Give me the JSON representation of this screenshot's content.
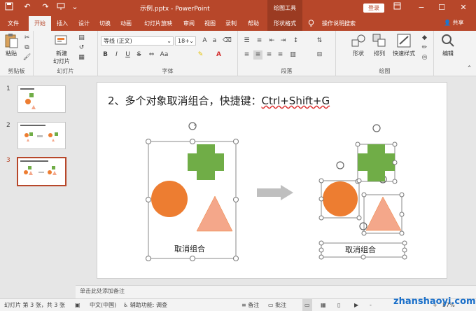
{
  "titlebar": {
    "file_title": "示例.pptx  -  PowerPoint",
    "context_label": "绘图工具",
    "login_label": "登录"
  },
  "tabs": {
    "items": [
      "文件",
      "开始",
      "插入",
      "设计",
      "切换",
      "动画",
      "幻灯片放映",
      "审阅",
      "视图",
      "录制",
      "帮助",
      "形状格式"
    ],
    "tell_me": "操作说明搜索",
    "share": "共享"
  },
  "ribbon": {
    "clipboard": {
      "paste": "粘贴",
      "label": "剪贴板"
    },
    "slides": {
      "new_slide_line1": "新建",
      "new_slide_line2": "幻灯片",
      "label": "幻灯片"
    },
    "font": {
      "font_name": "等线 (正文)",
      "font_size": "18+",
      "label": "字体",
      "bold": "B",
      "italic": "I",
      "underline": "U",
      "strike": "S",
      "font_color_glyph": "A"
    },
    "paragraph": {
      "label": "段落"
    },
    "drawing": {
      "shape": "形状",
      "arrange": "排列",
      "quick_styles": "快速样式",
      "label": "绘图"
    },
    "editing": {
      "label": "编辑"
    }
  },
  "slides_panel": {
    "numbers": [
      "1",
      "2",
      "3"
    ],
    "active_index": 3
  },
  "slide": {
    "title_prefix": "2、多个对象取消组合，快捷键：",
    "title_shortcut": "Ctrl+Shift+G",
    "left_caption": "取消组合",
    "right_caption": "取消组合"
  },
  "notes": {
    "placeholder": "单击此处添加备注"
  },
  "statusbar": {
    "slide_info": "幻灯片 第 3 张，共 3 张",
    "language": "中文(中国)",
    "accessibility": "辅助功能: 调查",
    "notes": "备注",
    "comments": "批注",
    "zoom_minus": "-",
    "zoom_plus": "+",
    "zoom": "57%"
  },
  "watermark": "zhanshaoyi.com",
  "colors": {
    "accent": "#b7472a",
    "green_shape": "#70ad47",
    "orange_shape": "#ed7d31",
    "triangle": "#f4a78a",
    "arrow": "#bfbfbf"
  }
}
